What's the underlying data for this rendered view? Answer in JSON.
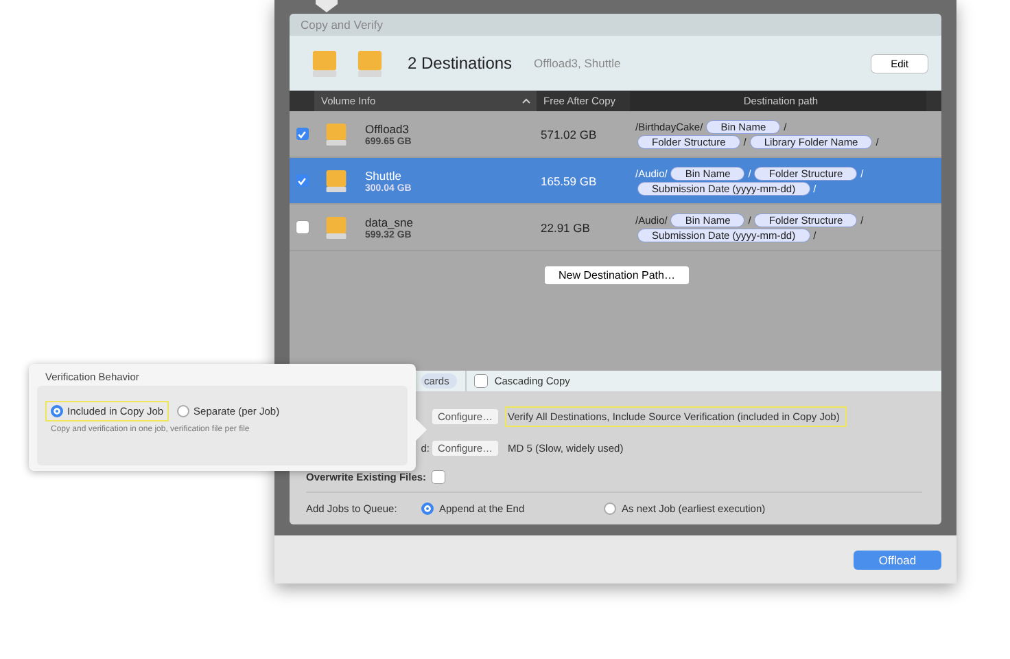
{
  "panel": {
    "title": "Copy and Verify"
  },
  "summary": {
    "title": "2 Destinations",
    "names": "Offload3, Shuttle",
    "edit_button": "Edit"
  },
  "table": {
    "columns": [
      {
        "label": "Volume Info",
        "sorted": true
      },
      {
        "label": "Free After Copy",
        "sorted": false
      },
      {
        "label": "Destination path",
        "sorted": false
      }
    ],
    "rows": [
      {
        "checked": true,
        "selected": false,
        "name": "Offload3",
        "size": "699.65 GB",
        "free": "571.02 GB",
        "path": [
          [
            {
              "kind": "text",
              "text": "/BirthdayCake/"
            },
            {
              "kind": "token",
              "text": "Bin Name"
            },
            {
              "kind": "text",
              "text": "/"
            }
          ],
          [
            {
              "kind": "token",
              "text": "Folder Structure"
            },
            {
              "kind": "text",
              "text": "/"
            },
            {
              "kind": "token",
              "text": "Library Folder Name"
            },
            {
              "kind": "text",
              "text": "/"
            }
          ]
        ]
      },
      {
        "checked": true,
        "selected": true,
        "name": "Shuttle",
        "size": "300.04 GB",
        "free": "165.59 GB",
        "path": [
          [
            {
              "kind": "text",
              "text": "/Audio/"
            },
            {
              "kind": "token",
              "text": "Bin Name"
            },
            {
              "kind": "text",
              "text": "/"
            },
            {
              "kind": "token",
              "text": "Folder Structure"
            },
            {
              "kind": "text",
              "text": "/"
            }
          ],
          [
            {
              "kind": "token",
              "text": "Submission Date (yyyy-mm-dd)"
            },
            {
              "kind": "text",
              "text": "/"
            }
          ]
        ]
      },
      {
        "checked": false,
        "selected": false,
        "name": "data_sne",
        "size": "599.32 GB",
        "free": "22.91 GB",
        "path": [
          [
            {
              "kind": "text",
              "text": "/Audio/"
            },
            {
              "kind": "token",
              "text": "Bin Name"
            },
            {
              "kind": "text",
              "text": "/"
            },
            {
              "kind": "token",
              "text": "Folder Structure"
            },
            {
              "kind": "text",
              "text": "/"
            }
          ],
          [
            {
              "kind": "token",
              "text": "Submission Date (yyyy-mm-dd)"
            },
            {
              "kind": "text",
              "text": "/"
            }
          ]
        ]
      }
    ]
  },
  "new_path_button": "New Destination Path…",
  "options_bar": {
    "tab": "cards",
    "cascading": {
      "label": "Cascading Copy",
      "checked": false
    }
  },
  "settings": [
    {
      "kind": "configure",
      "button": "Configure…",
      "value": "Verify All Destinations, Include Source Verification (included in Copy Job)",
      "highlighted": true
    },
    {
      "kind": "configure",
      "label": "d:",
      "button": "Configure…",
      "value": "MD 5 (Slow, widely used)",
      "highlighted": false
    },
    {
      "kind": "checkbox",
      "label": "Overwrite Existing Files:",
      "checked": false
    },
    {
      "kind": "radio",
      "label": "Add Jobs to Queue:",
      "options": [
        {
          "label": "Append at the End",
          "selected": true
        },
        {
          "label": "As next Job (earliest execution)",
          "selected": false
        }
      ]
    }
  ],
  "footer": {
    "button": "Offload"
  },
  "popover": {
    "title": "Verification Behavior",
    "options": [
      {
        "label": "Included in Copy Job",
        "selected": true,
        "highlighted": true
      },
      {
        "label": "Separate (per Job)",
        "selected": false,
        "highlighted": false
      }
    ],
    "hint": "Copy and verification in one job, verification file per file"
  }
}
